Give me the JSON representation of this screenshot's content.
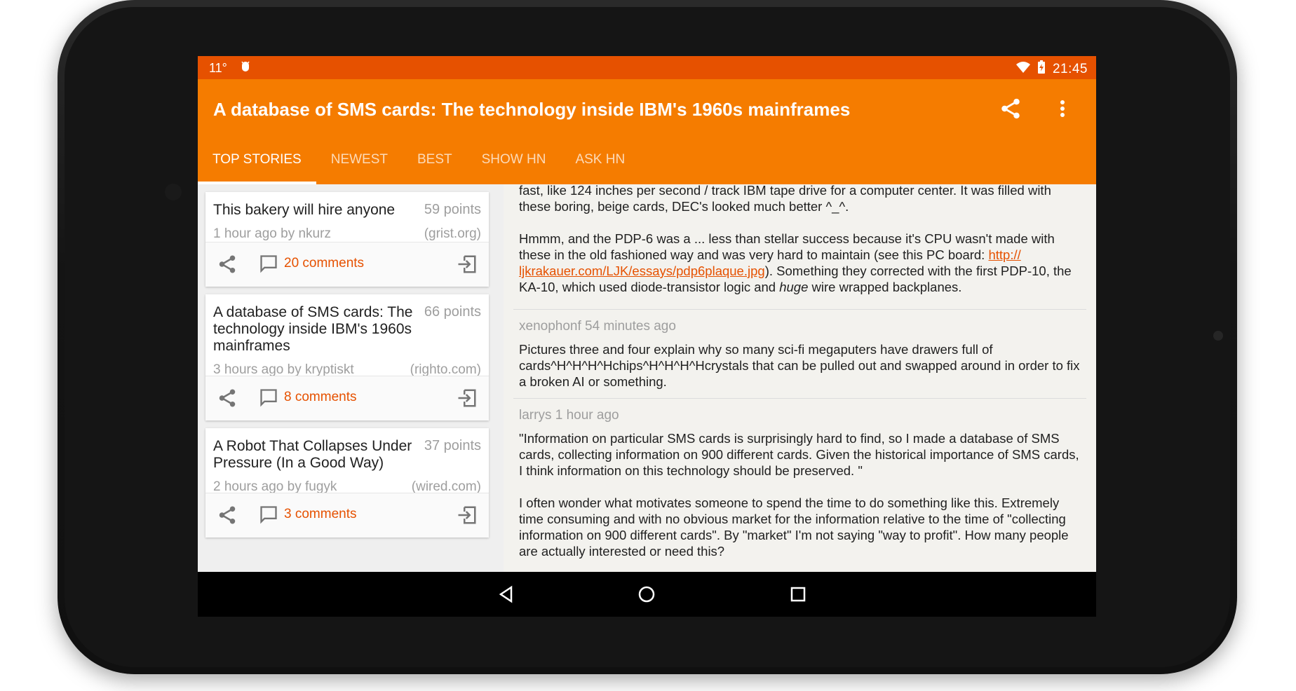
{
  "status": {
    "left_icons": [
      "signal-icon",
      "android-debug-icon"
    ],
    "signal_text": "11°",
    "time": "21:45",
    "right_icons": [
      "wifi-icon",
      "battery-icon"
    ]
  },
  "appbar": {
    "title": "A database of SMS cards: The technology inside IBM's 1960s mainframes",
    "actions": [
      "share-icon",
      "overflow-menu-icon"
    ]
  },
  "tabs": [
    {
      "label": "TOP STORIES",
      "active": true
    },
    {
      "label": "NEWEST",
      "active": false
    },
    {
      "label": "BEST",
      "active": false
    },
    {
      "label": "SHOW HN",
      "active": false
    },
    {
      "label": "ASK HN",
      "active": false
    }
  ],
  "stories": [
    {
      "title": "This bakery will hire anyone",
      "points": "59 points",
      "meta": "1 hour ago by nkurz",
      "domain": "(grist.org)",
      "comments": "20 comments"
    },
    {
      "title": "A database of SMS cards: The technology inside IBM's 1960s mainframes",
      "points": "66 points",
      "meta": "3 hours ago by kryptiskt",
      "domain": "(righto.com)",
      "comments": "8 comments"
    },
    {
      "title": "A Robot That Collapses Under Pressure (In a Good Way)",
      "points": "37 points",
      "meta": "2 hours ago by fugyk",
      "domain": "(wired.com)",
      "comments": "3 comments"
    }
  ],
  "comments": [
    {
      "author": "",
      "p1": "fast, like 124 inches per second / track IBM tape drive for a computer center. It was filled with these boring, beige cards, DEC's looked much better ^_^.",
      "p2_before": "Hmmm, and the PDP-6 was a ... less than stellar success because it's CPU wasn't made with these in the old fashioned way and was very hard to maintain (see this PC board: ",
      "p2_link": "http:// ljkrakauer.com/LJK/essays/pdp6plaque.jpg",
      "p2_after": "). Something they corrected with the first PDP-10, the KA-10, which used diode-transistor logic and ",
      "p2_em": "huge",
      "p2_end": " wire wrapped backplanes."
    },
    {
      "author": "xenophonf 54 minutes ago",
      "p1": "Pictures three and four explain why so many sci-fi megaputers have drawers full of cards^H^H^H^Hchips^H^H^H^Hcrystals that can be pulled out and swapped around in order to fix a broken AI or something."
    },
    {
      "author": "larrys 1 hour ago",
      "p1": "\"Information on particular SMS cards is surprisingly hard to find, so I made a database of SMS cards, collecting information on 900 different cards. Given the historical importance of SMS cards, I think information on this technology should be preserved. \"",
      "p2": "I often wonder what motivates someone to spend the time to do something like this. Extremely time consuming and with no obvious market for the information relative to the time of \"collecting information on 900 different cards\". By \"market\" I'm not saying \"way to profit\". How many people are actually interested or need this?"
    }
  ],
  "navbar": [
    "back-icon",
    "home-icon",
    "recents-icon"
  ],
  "colors": {
    "status_bar": "#e65100",
    "app_bar": "#f57c00",
    "accent": "#e65100"
  }
}
